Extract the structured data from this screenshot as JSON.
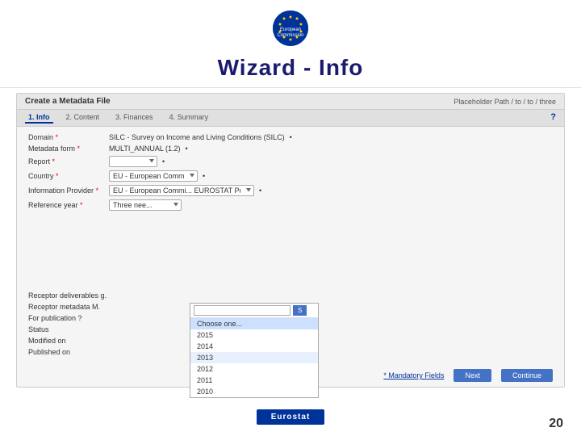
{
  "header": {
    "logo_text": "European\nCommission",
    "title": "Wizard - Info"
  },
  "panel": {
    "title": "Create a Metadata File",
    "path": "Placeholder Path / to / to / three"
  },
  "wizard_steps": [
    {
      "label": "1. Info",
      "active": true
    },
    {
      "label": "2. Content",
      "active": false
    },
    {
      "label": "3. Finances",
      "active": false
    },
    {
      "label": "4. Summary",
      "active": false
    }
  ],
  "form": {
    "rows": [
      {
        "label": "Domain *",
        "value": "SILC - Survey on Income and Living Conditions (SILC)",
        "type": "text",
        "bullet": true
      },
      {
        "label": "Metadata form *",
        "value": "MULTI_ANNUAL (1.2)",
        "type": "text",
        "bullet": true
      },
      {
        "label": "Report *",
        "value": "",
        "type": "select",
        "options": []
      },
      {
        "label": "Country *",
        "value": "EU - European Commi...",
        "type": "select",
        "options": []
      },
      {
        "label": "Information Provider *",
        "value": "EU - European Commi... EUROSTAT Publish (Eurostat)",
        "type": "select",
        "options": []
      }
    ],
    "reference_year_label": "Reference year *",
    "reference_year_value": "Three nee...",
    "receptor_deliverables_label": "Receptor deliverables g.",
    "receptor_metadata_label": "Receptor metadata M.",
    "for_publication_label": "For publication ?",
    "status_label": "Status",
    "modified_on_label": "Modified on",
    "published_on_label": "Published on",
    "dropdown_years": [
      "Choose one...",
      "2015",
      "2014",
      "2013",
      "2012",
      "2011",
      "2010"
    ]
  },
  "bottom": {
    "mandatory_link": "* Mandatory Fields",
    "next_button": "Next",
    "continue_btn": "Continue"
  },
  "footer": {
    "eurostat_label": "Eurostat"
  },
  "page_number": "20"
}
